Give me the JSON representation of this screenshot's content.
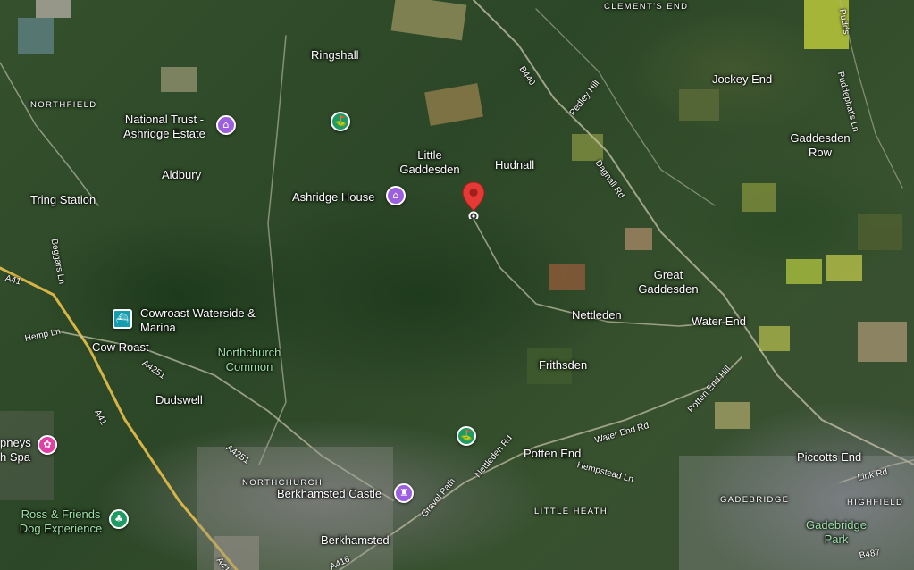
{
  "map": {
    "view": "satellite",
    "places": {
      "clements_end": "CLEMENT'S END",
      "ringshall": "Ringshall",
      "jockey_end": "Jockey End",
      "northfield": "NORTHFIELD",
      "national_trust": "National Trust - Ashridge Estate",
      "little_gaddesden": "Little Gaddesden",
      "hudnall": "Hudnall",
      "gaddesden_row": "Gaddesden Row",
      "aldbury": "Aldbury",
      "tring_station": "Tring Station",
      "ashridge_house": "Ashridge House",
      "great_gaddesden": "Great Gaddesden",
      "cowroast_marina": "Cowroast Waterside & Marina",
      "nettleden": "Nettleden",
      "water_end": "Water End",
      "cow_roast": "Cow Roast",
      "northchurch_common": "Northchurch Common",
      "frithsden": "Frithsden",
      "dudswell": "Dudswell",
      "champneys": "pneys h Spa",
      "potten_end": "Potten End",
      "piccotts_end": "Piccotts End",
      "northchurch": "NORTHCHURCH",
      "berkhamsted_castle": "Berkhamsted Castle",
      "gadebridge": "GADEBRIDGE",
      "highfield": "HIGHFIELD",
      "ross_friends": "Ross & Friends Dog Experience",
      "little_heath": "LITTLE HEATH",
      "gadebridge_park": "Gadebridge Park",
      "berkhamsted": "Berkhamsted"
    },
    "roads": {
      "b4506": "B440",
      "pedley_hill": "Pedley Hill",
      "dagnall_rd": "Dagnall Rd",
      "pudds_lane": "Pudds",
      "puddephats": "Puddephat's Ln",
      "beggars_ln": "Beggars Ln",
      "a41_top": "A41",
      "hemp_ln": "Hemp Ln",
      "a4251_a": "A4251",
      "a41_mid": "A41",
      "a4251_b": "A4251",
      "potten_end_hill": "Potten End Hill",
      "water_end_rd": "Water End Rd",
      "hempstead_ln": "Hempstead Ln",
      "nettleden_rd": "Nettleden Rd",
      "gravel_path": "Gravel Path",
      "link_rd": "Link Rd",
      "a416": "A416",
      "a41_bottom": "A41",
      "b487": "B487"
    },
    "colors": {
      "pin": "#e53935",
      "poi_purple": "#9b5fe0",
      "poi_green": "#1e9a64",
      "poi_teal": "#129eaf",
      "poi_pink": "#e03fa5"
    }
  }
}
